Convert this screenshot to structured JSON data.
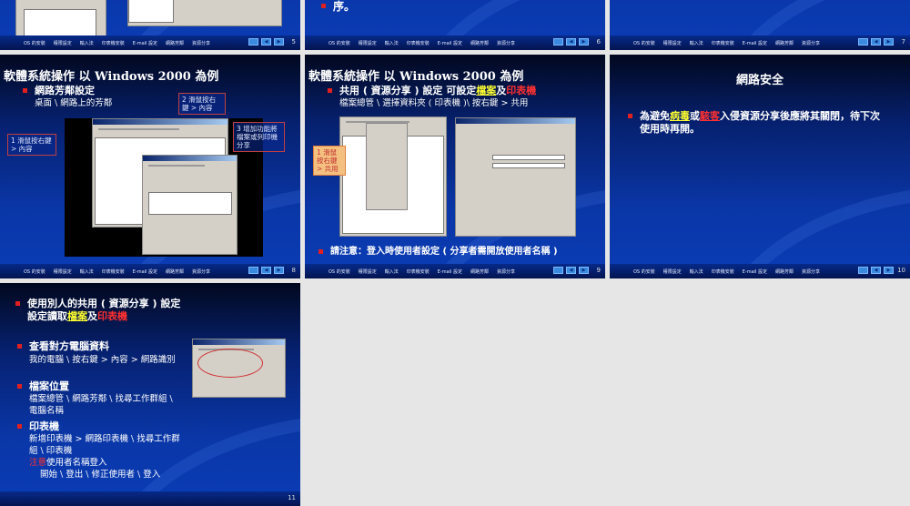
{
  "nav": [
    "OS 的安裝",
    "權限設定",
    "輸入法",
    "印表機安裝",
    "E-mail 設定",
    "網路芳鄰",
    "資源分享"
  ],
  "navbtns": {
    "home": "home-icon",
    "prev": "◀",
    "next": "▶"
  },
  "slides": {
    "s5": {
      "num": "5"
    },
    "s6": {
      "num": "6",
      "text": "序。"
    },
    "s7": {
      "num": "7"
    },
    "s8": {
      "num": "8",
      "title": "軟體系統操作  以 Windows 2000  為例",
      "bullet": "網路芳鄰設定",
      "sub": "桌面 \\ 網路上的芳鄰",
      "call1": "1 滑鼠按右鍵 > 內容",
      "call2": "2 滑鼠按右鍵 > 內容",
      "call3": "3 增加功能將檔案或列印機分享"
    },
    "s9": {
      "num": "9",
      "title": "軟體系統操作  以 Windows 2000  為例",
      "bullet_a": "共用 ( 資源分享 ) 設定 可設定",
      "files": "檔案",
      "and": "及",
      "printer": "印表機",
      "sub": "檔案總管 \\ 選擇資料夾 ( 印表機 )\\ 按右鍵 > 共用",
      "call": "1 滑鼠按右鍵 > 共用",
      "note": "請注意：登入時使用者設定 ( 分享者需開放使用者名稱 )"
    },
    "s10": {
      "num": "10",
      "title": "網路安全",
      "a": "為避免",
      "virus": "病毒",
      "or": "或",
      "hacker": "駭客",
      "b": "入侵資源分享後應將其關閉，待下次使用時再開。"
    },
    "s11": {
      "num": "11",
      "b1a": "使用別人的共用 ( 資源分享 ) 設定",
      "b1b": "設定讀取",
      "files": "檔案",
      "and": "及",
      "printer": "印表機",
      "b2": "查看對方電腦資料",
      "b2s": "我的電腦 \\ 按右鍵 > 內容 > 網路識別",
      "b3": "檔案位置",
      "b3s": "檔案總管 \\ 網路芳鄰 \\ 找尋工作群組 \\ 電腦名稱",
      "b4": "印表機",
      "b4s": "新增印表機 > 網路印表機 \\ 找尋工作群組 \\ 印表機",
      "note": "注意",
      "b4n": "使用者名稱登入",
      "b4l": "開始 \\ 登出 \\ 修正使用者 \\ 登入"
    }
  }
}
